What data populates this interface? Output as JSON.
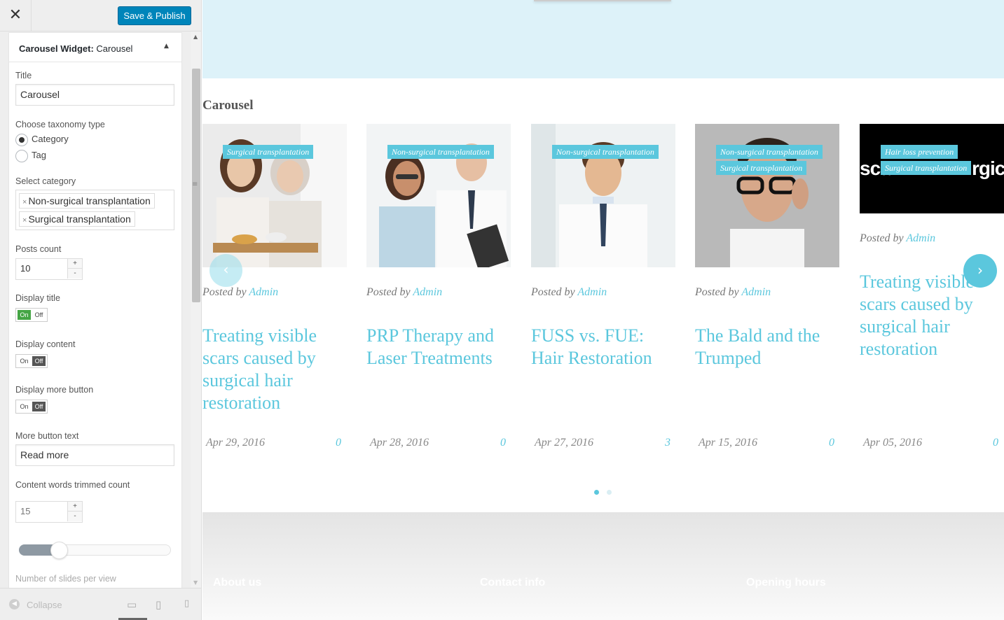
{
  "panel": {
    "close_glyph": "✕",
    "publish_label": "Save & Publish",
    "widget_title_bold": "Carousel Widget:",
    "widget_title_name": "Carousel",
    "title_label": "Title",
    "title_value": "Carousel",
    "taxonomy_label": "Choose taxonomy type",
    "taxonomy_options": [
      "Category",
      "Tag"
    ],
    "taxonomy_selected": "Category",
    "category_label": "Select category",
    "categories": [
      "Non-surgical transplantation",
      "Surgical transplantation"
    ],
    "posts_count_label": "Posts count",
    "posts_count_value": "10",
    "display_title_label": "Display title",
    "display_title": "On",
    "display_content_label": "Display content",
    "display_content": "Off",
    "display_more_label": "Display more button",
    "display_more": "Off",
    "toggle_on": "On",
    "toggle_off": "Off",
    "more_text_label": "More button text",
    "more_text_value": "Read more",
    "trim_label": "Content words trimmed count",
    "trim_value": "15",
    "slides_per_view_label": "Number of slides per view",
    "slides_per_view_level": 0.27,
    "collapse_label": "Collapse",
    "stepper_plus": "+",
    "stepper_minus": "-"
  },
  "preview": {
    "section_title": "Carousel",
    "posted_by": "Posted by",
    "prev_glyph": "‹",
    "next_glyph": "›",
    "posts": [
      {
        "title": "Treating visible scars caused by surgical hair restoration",
        "author": "Admin",
        "date": "Apr 29, 2016",
        "comments": "0",
        "tags": [
          "Surgical transplantation"
        ]
      },
      {
        "title": "PRP Therapy and Laser Treatments",
        "author": "Admin",
        "date": "Apr 28, 2016",
        "comments": "0",
        "tags": [
          "Non-surgical transplantation"
        ]
      },
      {
        "title": "FUSS vs. FUE: Hair Restoration",
        "author": "Admin",
        "date": "Apr 27, 2016",
        "comments": "3",
        "tags": [
          "Non-surgical transplantation"
        ]
      },
      {
        "title": "The Bald and the Trumped",
        "author": "Admin",
        "date": "Apr 15, 2016",
        "comments": "0",
        "tags": [
          "Non-surgical transplantation",
          "Surgical transplantation"
        ]
      },
      {
        "title": "Treating visible scars caused by surgical hair restoration",
        "author": "Admin",
        "date": "Apr 05, 2016",
        "comments": "0",
        "tags": [
          "Hair loss prevention",
          "Surgical transplantation"
        ]
      }
    ],
    "fifth_image_text": "scar",
    "fifth_image_text_right": "rgica",
    "footer_headings": [
      "About us",
      "Contact info",
      "Opening hours"
    ],
    "pagination": {
      "current": 1,
      "total": 2
    }
  },
  "colors": {
    "accent": "#5bc7dd",
    "publish": "#0085ba",
    "hero_bg": "#ddf2f9",
    "toggle_on": "#45a545"
  }
}
